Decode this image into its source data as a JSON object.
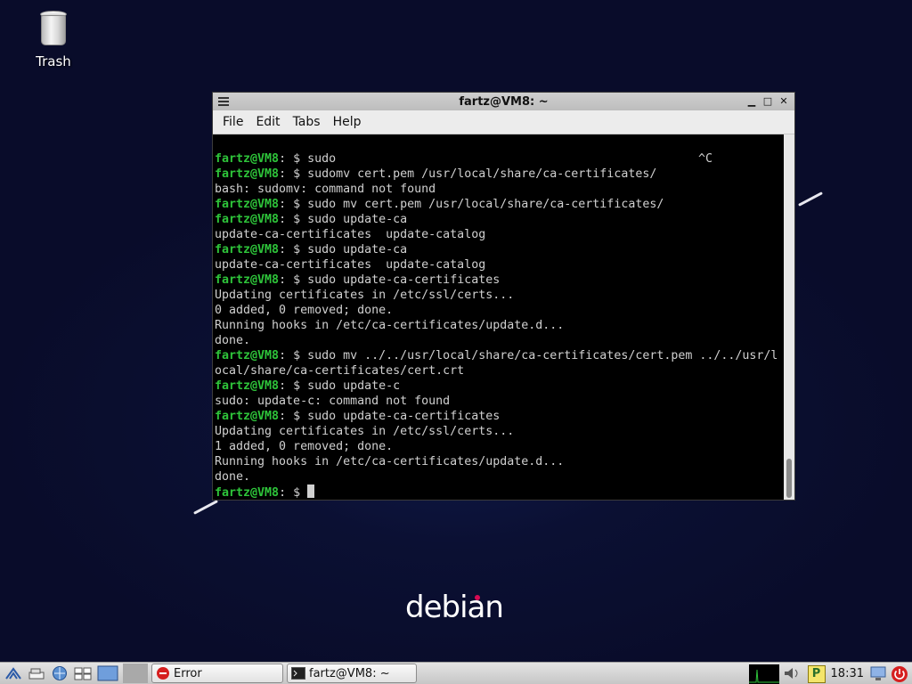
{
  "desktop": {
    "trash_label": "Trash",
    "logo_text": "debian",
    "logo_dot_color": "#d70a53"
  },
  "window": {
    "title": "fartz@VM8: ~",
    "controls": {
      "minimize": "▁",
      "maximize": "□",
      "close": "✕"
    },
    "menu": [
      "File",
      "Edit",
      "Tabs",
      "Help"
    ]
  },
  "terminal": {
    "prompt": "fartz@VM8",
    "prompt_color": "#2ec43a",
    "lines": [
      {
        "prompt": true,
        "text": ": $ sudo",
        "tail": "^C"
      },
      {
        "prompt": true,
        "text": ": $ sudomv cert.pem /usr/local/share/ca-certificates/"
      },
      {
        "prompt": false,
        "text": "bash: sudomv: command not found"
      },
      {
        "prompt": true,
        "text": ": $ sudo mv cert.pem /usr/local/share/ca-certificates/"
      },
      {
        "prompt": true,
        "text": ": $ sudo update-ca"
      },
      {
        "prompt": false,
        "text": "update-ca-certificates  update-catalog"
      },
      {
        "prompt": true,
        "text": ": $ sudo update-ca"
      },
      {
        "prompt": false,
        "text": "update-ca-certificates  update-catalog"
      },
      {
        "prompt": true,
        "text": ": $ sudo update-ca-certificates"
      },
      {
        "prompt": false,
        "text": "Updating certificates in /etc/ssl/certs..."
      },
      {
        "prompt": false,
        "text": "0 added, 0 removed; done."
      },
      {
        "prompt": false,
        "text": "Running hooks in /etc/ca-certificates/update.d..."
      },
      {
        "prompt": false,
        "text": "done."
      },
      {
        "prompt": true,
        "text": ": $ sudo mv ../../usr/local/share/ca-certificates/cert.pem ../../usr/l"
      },
      {
        "prompt": false,
        "text": "ocal/share/ca-certificates/cert.crt"
      },
      {
        "prompt": true,
        "text": ": $ sudo update-c"
      },
      {
        "prompt": false,
        "text": "sudo: update-c: command not found"
      },
      {
        "prompt": true,
        "text": ": $ sudo update-ca-certificates"
      },
      {
        "prompt": false,
        "text": "Updating certificates in /etc/ssl/certs..."
      },
      {
        "prompt": false,
        "text": "1 added, 0 removed; done."
      },
      {
        "prompt": false,
        "text": "Running hooks in /etc/ca-certificates/update.d..."
      },
      {
        "prompt": false,
        "text": "done."
      },
      {
        "prompt": true,
        "text": ": $ ",
        "cursor": true
      }
    ]
  },
  "taskbar": {
    "tasks": [
      {
        "label": "Error",
        "icon": "error-icon"
      },
      {
        "label": "fartz@VM8: ~",
        "icon": "terminal-icon"
      }
    ],
    "clock": "18:31",
    "tray_letter": "P"
  }
}
